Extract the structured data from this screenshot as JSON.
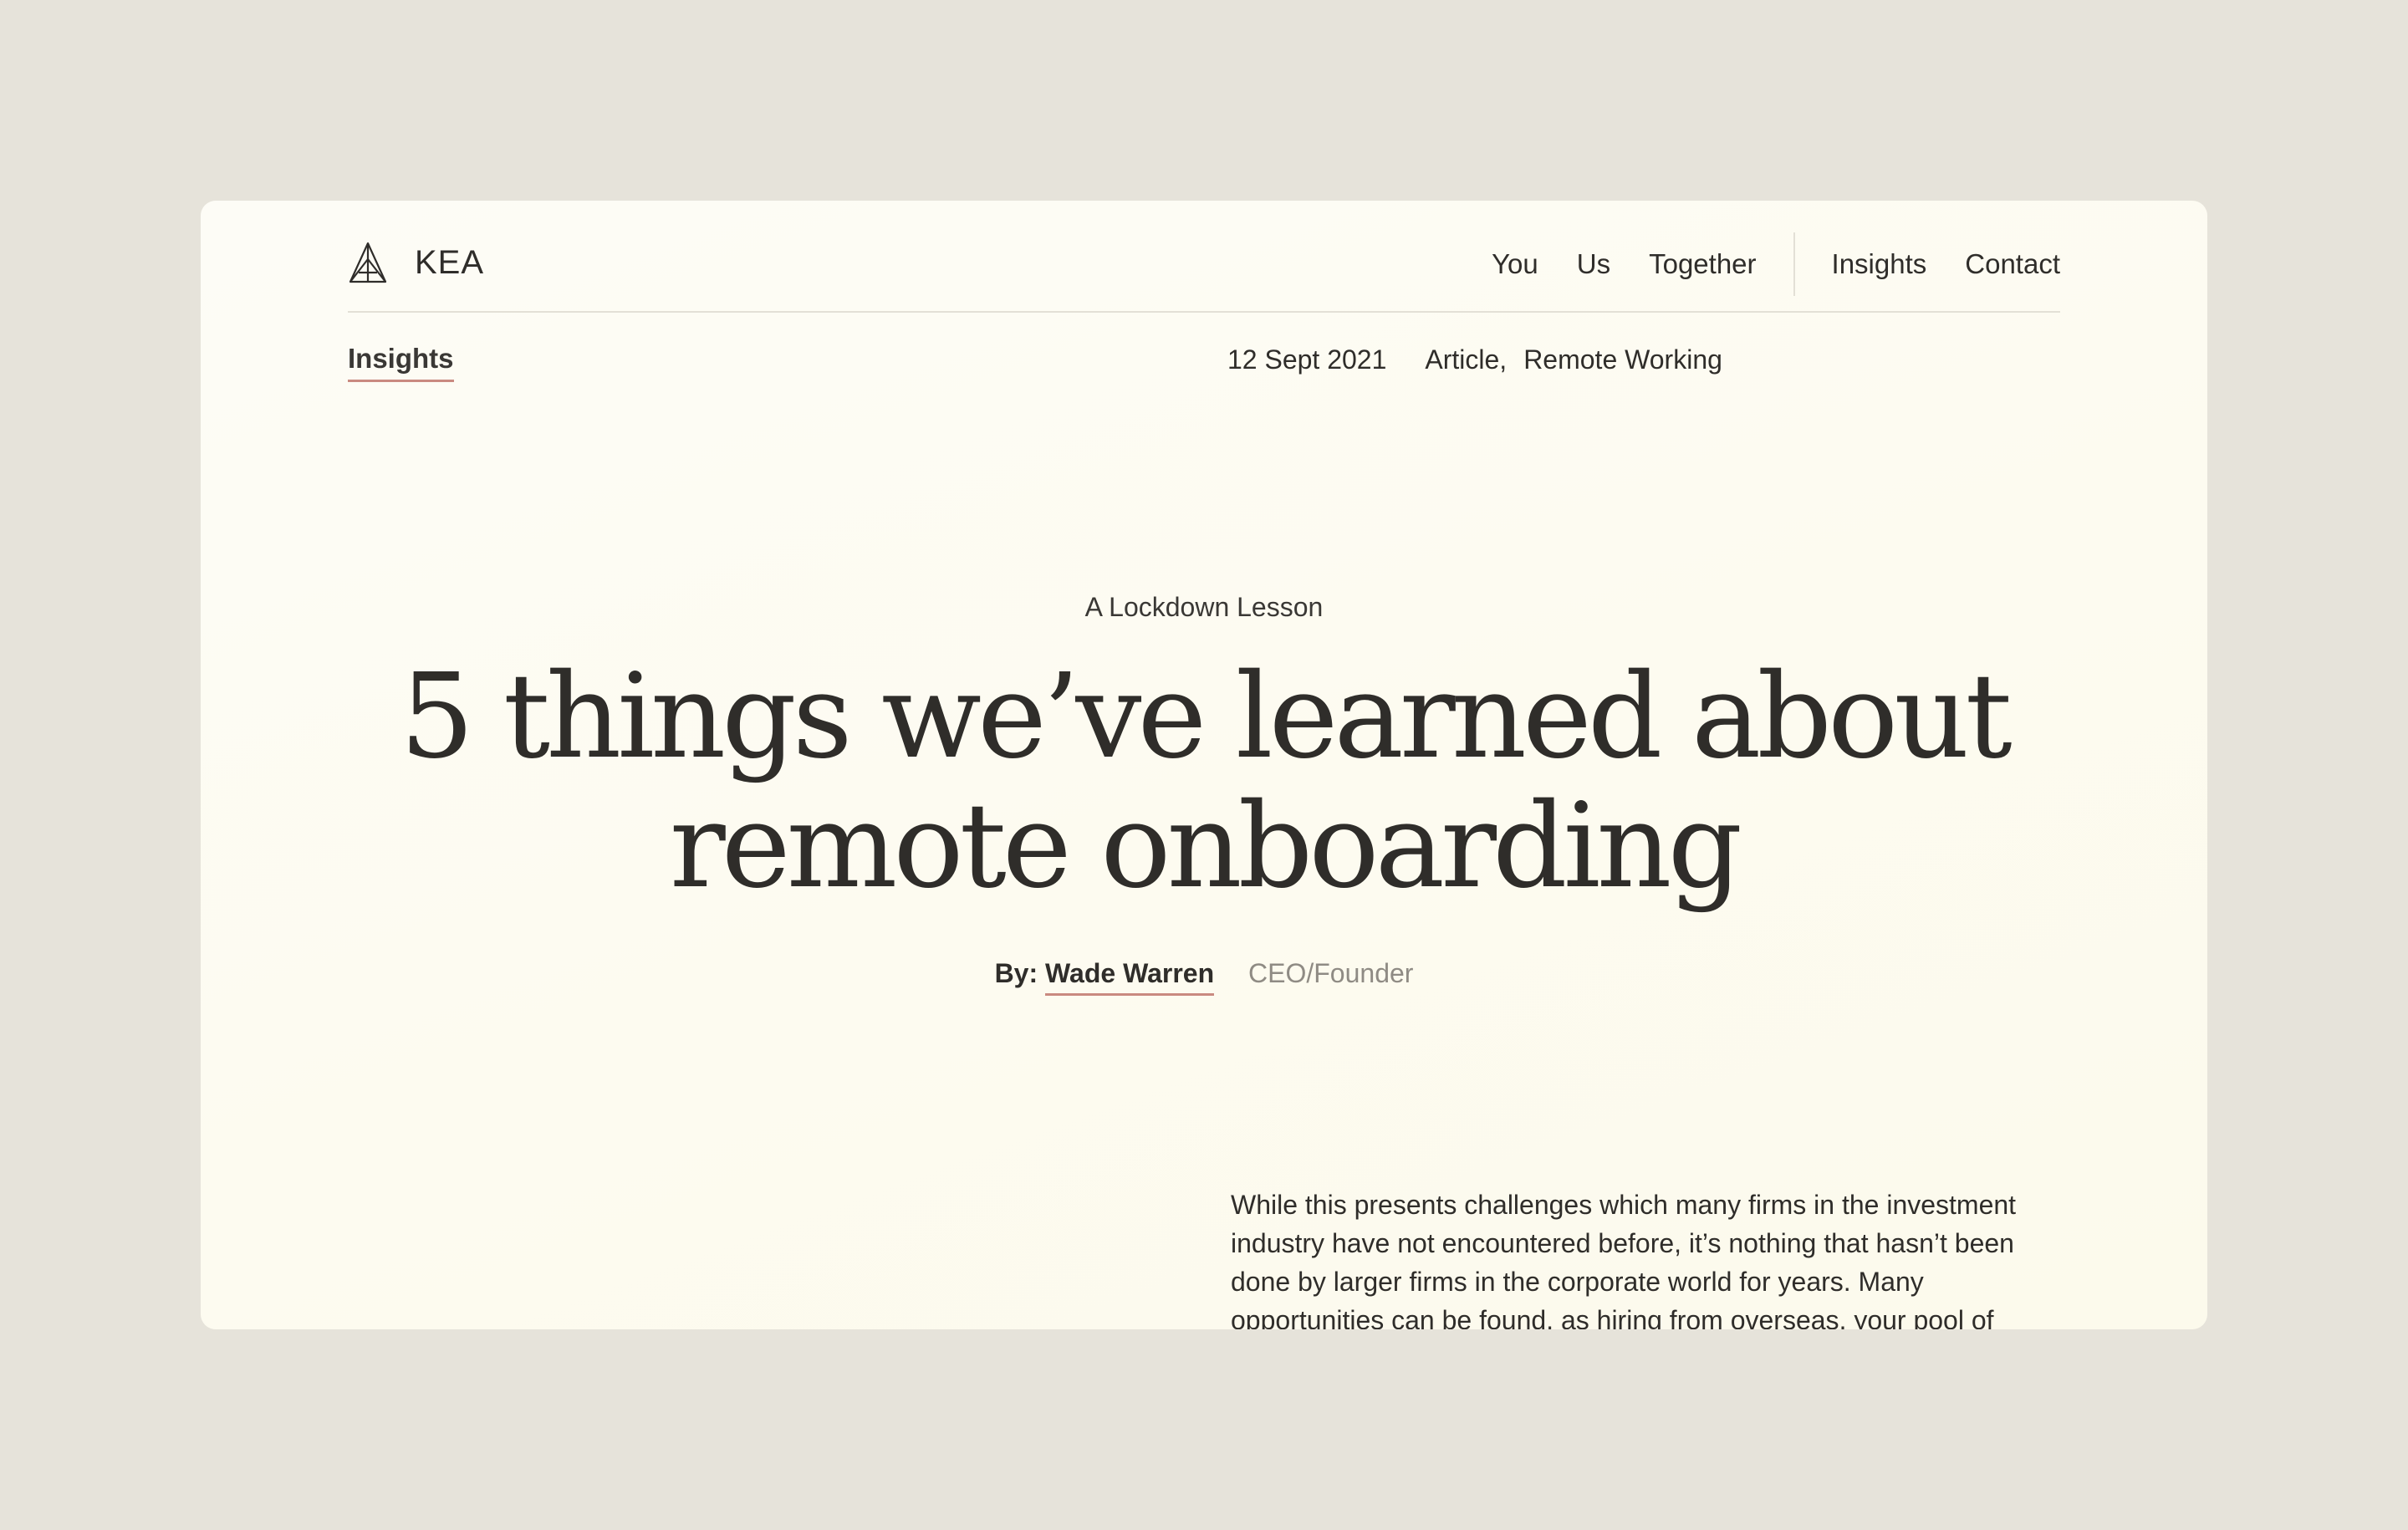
{
  "header": {
    "brand": "KEA",
    "nav": [
      {
        "label": "You"
      },
      {
        "label": "Us"
      },
      {
        "label": "Together"
      },
      {
        "label": "Insights"
      },
      {
        "label": "Contact"
      }
    ]
  },
  "subbar": {
    "breadcrumb": "Insights",
    "date": "12 Sept 2021",
    "tags": [
      "Article,",
      "Remote Working"
    ]
  },
  "article": {
    "eyebrow": "A Lockdown Lesson",
    "title_line1": "5 things we’ve learned about",
    "title_line2": "remote onboarding",
    "byline_prefix": "By:",
    "author": "Wade Warren",
    "author_role": "CEO/Founder",
    "body": "While this presents challenges which many firms in the investment industry have not encountered before, it’s nothing that hasn’t been done by larger firms in the corporate world for years. Many opportunities can be found, as hiring from overseas, your pool of"
  },
  "colors": {
    "background": "#e6e3da",
    "card": "#fdfcf4",
    "text": "#2f2d2a",
    "muted": "#8f8b84",
    "accent_underline": "#c98a80"
  },
  "icons": {
    "brand": "kea-pyramid-logo-icon"
  }
}
